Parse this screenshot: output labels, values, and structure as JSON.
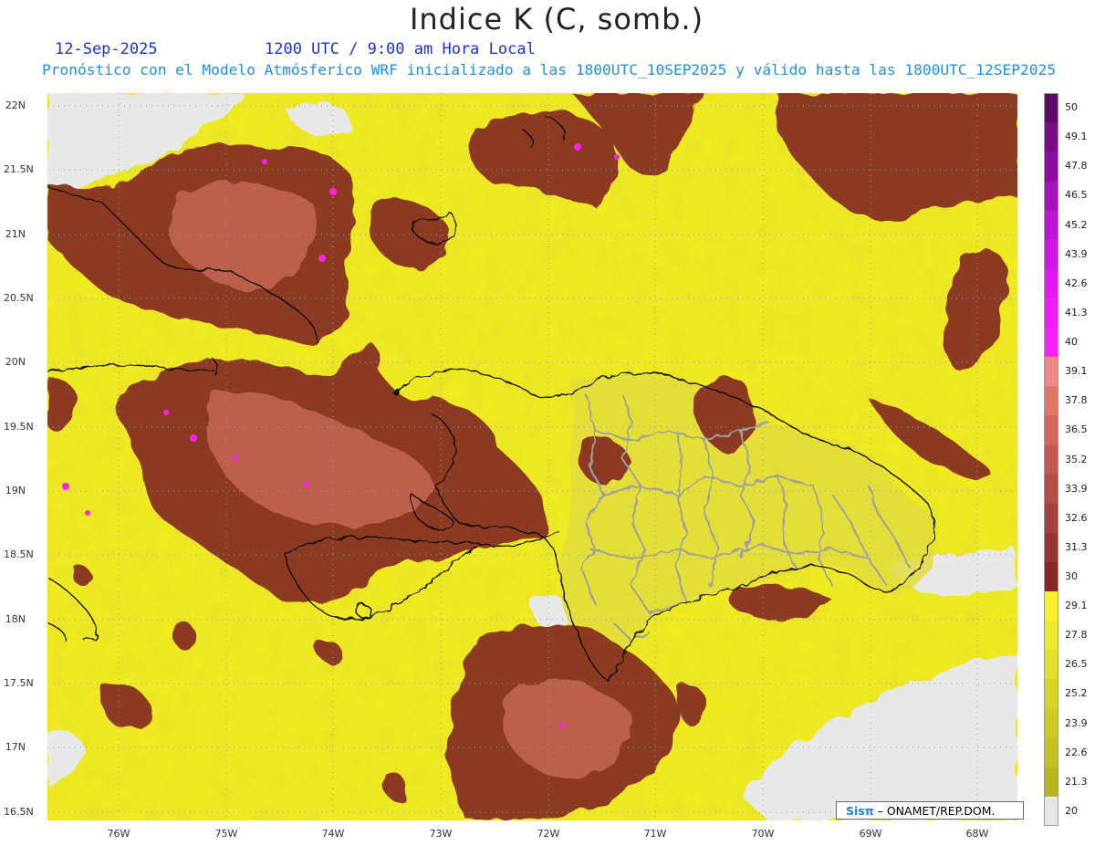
{
  "title": "Indice K (C, somb.)",
  "date_label": "12-Sep-2025",
  "time_label": "1200 UTC / 9:00 am Hora Local",
  "forecast_label": "Pronóstico con el Modelo Atmósferico WRF inicializado a las 1800UTC_10SEP2025 y válido hasta las  1800UTC_12SEP2025",
  "credit": {
    "brand": "Sisπ",
    "text": "– ONAMET/REP.DOM."
  },
  "map": {
    "lat_labels": [
      "22N",
      "21.5N",
      "21N",
      "20.5N",
      "20N",
      "19.5N",
      "19N",
      "18.5N",
      "18N",
      "17.5N",
      "17N",
      "16.5N"
    ],
    "lon_labels": [
      "76W",
      "75W",
      "74W",
      "73W",
      "72W",
      "71W",
      "70W",
      "69W",
      "68W"
    ],
    "colors": {
      "ocean_yellow": "#f3ee1f",
      "land_yellow": "#e6e03b",
      "storm_brown": "#8c3a22",
      "storm_core": "#c86a58",
      "magenta": "#ff22ee",
      "missing_gray": "#e8e8e8",
      "coast": "#111111",
      "province": "#a0a0a0"
    }
  },
  "colorbar": {
    "labels": [
      "50",
      "49.1",
      "47.8",
      "46.5",
      "45.2",
      "43.9",
      "42.6",
      "41.3",
      "40",
      "39.1",
      "37.8",
      "36.5",
      "35.2",
      "33.9",
      "32.6",
      "31.3",
      "30",
      "29.1",
      "27.8",
      "26.5",
      "25.2",
      "23.9",
      "22.6",
      "21.3",
      "20"
    ],
    "colors": [
      "#5d0a64",
      "#780c84",
      "#8e0ea2",
      "#a611bc",
      "#bb14d4",
      "#cf16e6",
      "#e219f2",
      "#f21df8",
      "#ff22ff",
      "#f08a84",
      "#e07766",
      "#d1675a",
      "#c45a50",
      "#b54e45",
      "#a5423a",
      "#943630",
      "#852a1e",
      "#f7f32a",
      "#ece82a",
      "#e2de29",
      "#d8d427",
      "#cdca24",
      "#c3c020",
      "#b8b51c",
      "#e6e6e6"
    ]
  }
}
